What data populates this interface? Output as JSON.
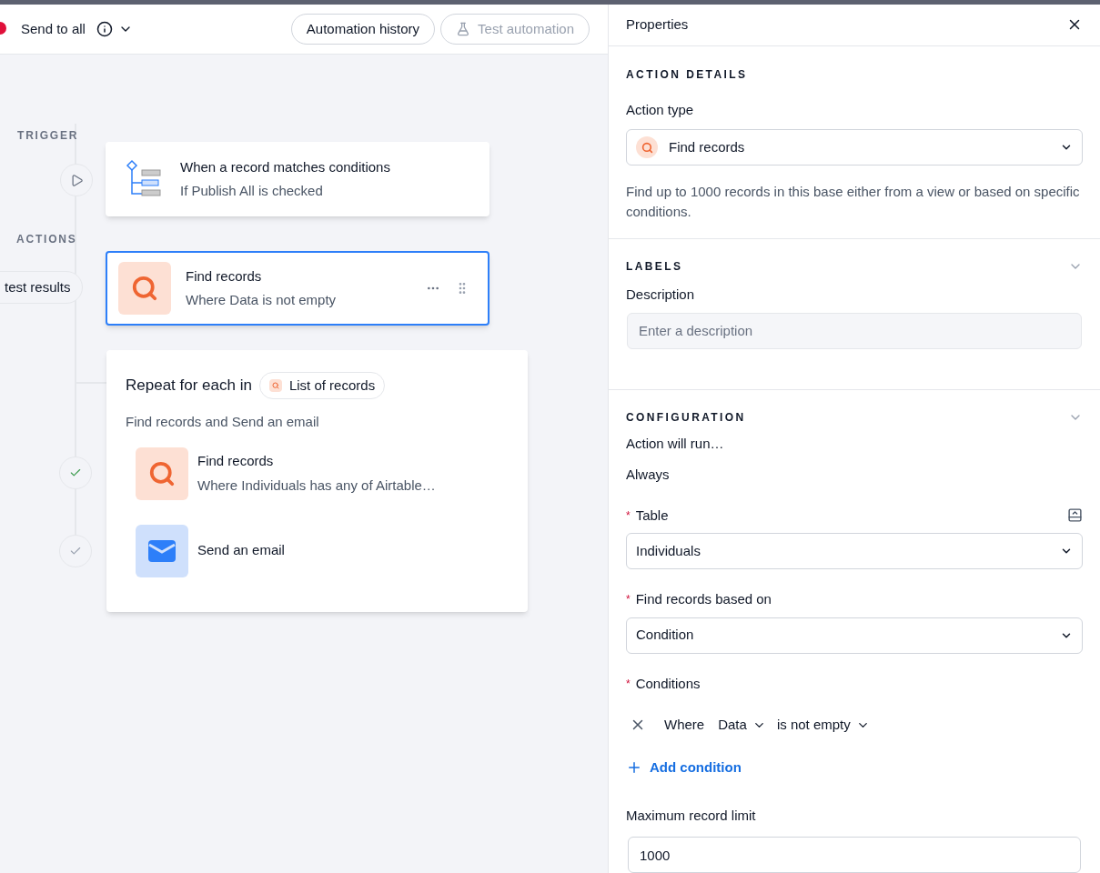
{
  "header": {
    "title": "Send to all",
    "buttons": [
      {
        "label": "Automation history",
        "disabled": false
      },
      {
        "label": "Test automation",
        "disabled": true
      }
    ]
  },
  "canvas": {
    "trigger_label": "TRIGGER",
    "actions_label": "ACTIONS",
    "test_results": "test results",
    "trigger": {
      "title": "When a record matches conditions",
      "subtitle": "If Publish All is checked",
      "selected": false
    },
    "action": {
      "title": "Find records",
      "subtitle": "Where Data is not empty",
      "selected": true
    },
    "loop": {
      "title": "Repeat for each in",
      "token": "List of records",
      "subtitle": "Find records and Send an email",
      "steps": [
        {
          "kind": "find",
          "title": "Find records",
          "subtitle": "Where Individuals has any of Airtable…",
          "completed": true
        },
        {
          "kind": "email",
          "title": "Send an email",
          "completed": false
        }
      ]
    }
  },
  "properties": {
    "title": "Properties",
    "action_details": {
      "heading": "ACTION DETAILS",
      "label": "Action type",
      "value": "Find records",
      "help": "Find up to 1000 records in this base either from a view or based on specific conditions."
    },
    "labels": {
      "heading": "LABELS",
      "label": "Description",
      "placeholder": "Enter a description"
    },
    "configuration": {
      "heading": "CONFIGURATION",
      "run_label": "Action will run…",
      "run_value": "Always",
      "table": {
        "label": "Table",
        "required_mark": "*",
        "value": "Individuals"
      },
      "based_on": {
        "label": "Find records based on",
        "required_mark": "*",
        "value": "Condition"
      },
      "conditions": {
        "label": "Conditions",
        "required_mark": "*",
        "items": [
          {
            "prefix": "Where",
            "field": "Data",
            "operator": "is not empty"
          }
        ],
        "add": "Add condition"
      },
      "limit": {
        "label": "Maximum record limit",
        "value": "1000"
      }
    }
  }
}
